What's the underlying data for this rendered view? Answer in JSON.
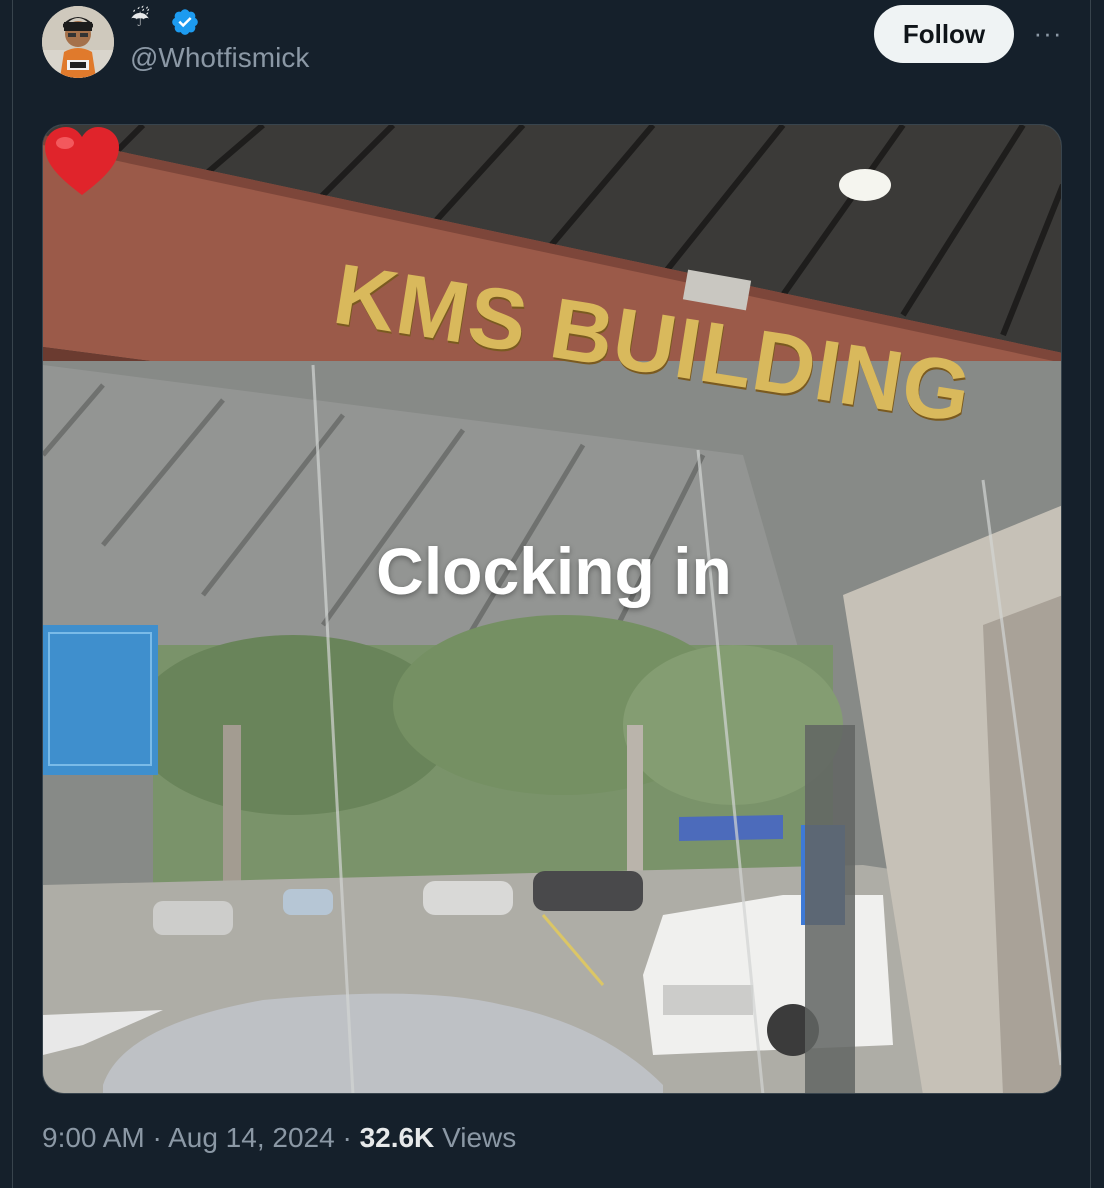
{
  "author": {
    "handle": "@Whotfismick",
    "name_emoji": "☔"
  },
  "actions": {
    "follow_label": "Follow",
    "more_label": "···"
  },
  "media": {
    "sign_text": "KMS BUILDING",
    "caption_text": "Clocking in"
  },
  "meta": {
    "time": "9:00 AM",
    "separator": " · ",
    "date": "Aug 14, 2024",
    "views_count": "32.6K",
    "views_label": "Views"
  },
  "colors": {
    "background": "#15202b",
    "follow_bg": "#eff3f4",
    "verified_blue": "#1d9bf0",
    "muted_text": "#8b98a5"
  }
}
